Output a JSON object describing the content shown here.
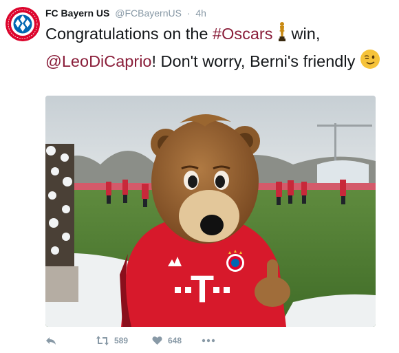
{
  "tweet": {
    "author_name": "FC Bayern US",
    "handle": "@FCBayernUS",
    "separator": "·",
    "time": "4h",
    "text": {
      "part1": "Congratulations on the ",
      "hashtag": "#Oscars",
      "part2": " win,",
      "mention": "@LeoDiCaprio",
      "part3": "! Don't worry, Berni's friendly"
    },
    "retweet_count": "589",
    "like_count": "648"
  },
  "icons": {
    "avatar": "fc-bayern-logo",
    "trophy": "oscar-trophy-emoji",
    "wink": "winking-face-emoji",
    "reply": "reply-icon",
    "retweet": "retweet-icon",
    "like": "heart-icon",
    "more": "more-icon"
  },
  "colors": {
    "link": "#8a1e3a",
    "muted": "#8899a6",
    "text": "#14171a",
    "bayern_red": "#dc052d"
  }
}
